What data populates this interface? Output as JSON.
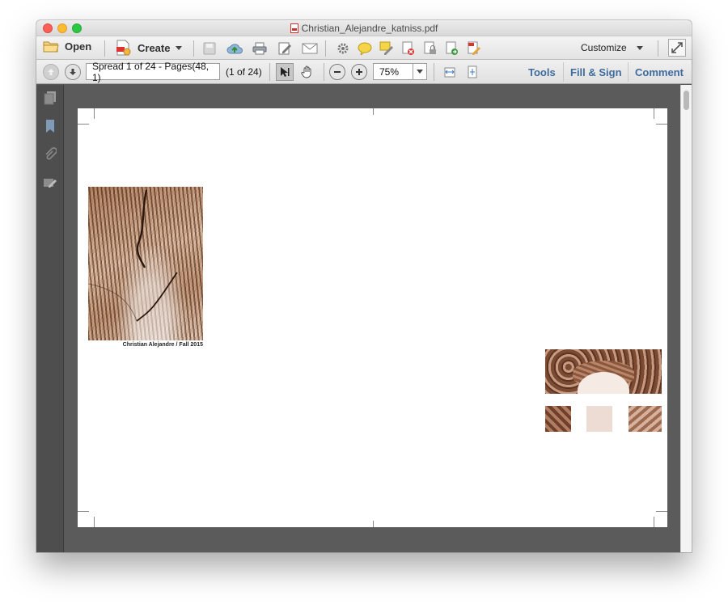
{
  "window": {
    "title": "Christian_Alejandre_katniss.pdf"
  },
  "toolbar": {
    "open_label": "Open",
    "create_label": "Create",
    "customize_label": "Customize",
    "icons": [
      "save-icon",
      "cloud-upload-icon",
      "print-icon",
      "edit-icon",
      "email-icon",
      "gear-icon",
      "comment-icon",
      "highlight-icon",
      "delete-page-icon",
      "lock-icon",
      "export-icon",
      "sign-icon",
      "expand-icon"
    ]
  },
  "nav": {
    "page_field_value": "Spread 1 of 24 - Pages(48, 1)",
    "page_count_text": "(1 of 24)",
    "zoom_value": "75%"
  },
  "panels": {
    "tools_label": "Tools",
    "fill_sign_label": "Fill & Sign",
    "comment_label": "Comment"
  },
  "document": {
    "caption": "Christian Alejandre / Fall 2015"
  },
  "colors": {
    "link_blue": "#3f6c9e",
    "doc_background": "#5b5b5b",
    "sepia": "#a36f4f"
  }
}
